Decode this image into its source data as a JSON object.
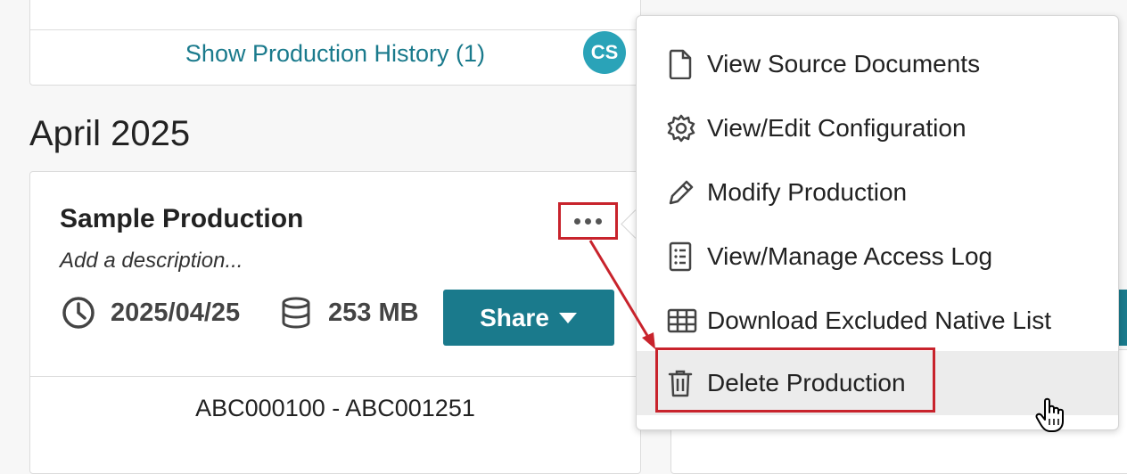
{
  "top_card": {
    "history_link": "Show Production History (1)",
    "avatar_initials": "CS"
  },
  "month_heading": "April 2025",
  "production": {
    "title": "Sample Production",
    "description_placeholder": "Add a description...",
    "date": "2025/04/25",
    "size": "253 MB",
    "share_label": "Share",
    "bates_range": "ABC000100 - ABC001251"
  },
  "menu": {
    "items": [
      {
        "label": "View Source Documents",
        "icon": "document-icon"
      },
      {
        "label": "View/Edit Configuration",
        "icon": "gear-icon"
      },
      {
        "label": "Modify Production",
        "icon": "pencil-icon"
      },
      {
        "label": "View/Manage Access Log",
        "icon": "list-icon"
      },
      {
        "label": "Download Excluded Native List",
        "icon": "table-icon"
      },
      {
        "label": "Delete Production",
        "icon": "trash-icon"
      }
    ]
  },
  "colors": {
    "accent": "#1a7a8c",
    "avatar": "#2aa3b8",
    "annotation": "#c8232c",
    "hover": "#ececec"
  }
}
